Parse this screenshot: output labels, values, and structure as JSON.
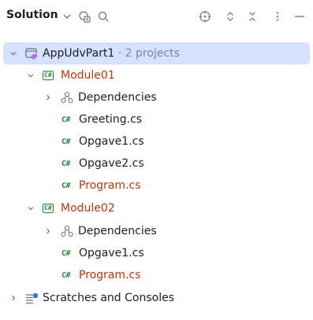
{
  "toolbar": {
    "title": "Solution",
    "icons": [
      "chevron-down-icon",
      "solution-filter-icon",
      "search-icon",
      "locate-icon",
      "expand-all-icon",
      "collapse-all-icon",
      "more-options-icon",
      "hide-icon"
    ]
  },
  "tree": {
    "solution": {
      "name": "AppUdvPart1",
      "suffix": "· 2 projects"
    },
    "modules": [
      {
        "name": "Module01",
        "badge": "C#",
        "dependencies": "Dependencies",
        "files": [
          {
            "badge": "C#",
            "name": "Greeting.cs"
          },
          {
            "badge": "C#",
            "name": "Opgave1.cs"
          },
          {
            "badge": "C#",
            "name": "Opgave2.cs"
          },
          {
            "badge": "C#",
            "name": "Program.cs"
          }
        ]
      },
      {
        "name": "Module02",
        "badge": "C#",
        "dependencies": "Dependencies",
        "files": [
          {
            "badge": "C#",
            "name": "Opgave1.cs"
          },
          {
            "badge": "C#",
            "name": "Program.cs"
          }
        ]
      }
    ],
    "scratches": "Scratches and Consoles"
  },
  "colors": {
    "selection": "#d5e1fd",
    "modified_text": "#b7370b",
    "csharp_green": "#208a3c",
    "muted": "#818594"
  }
}
